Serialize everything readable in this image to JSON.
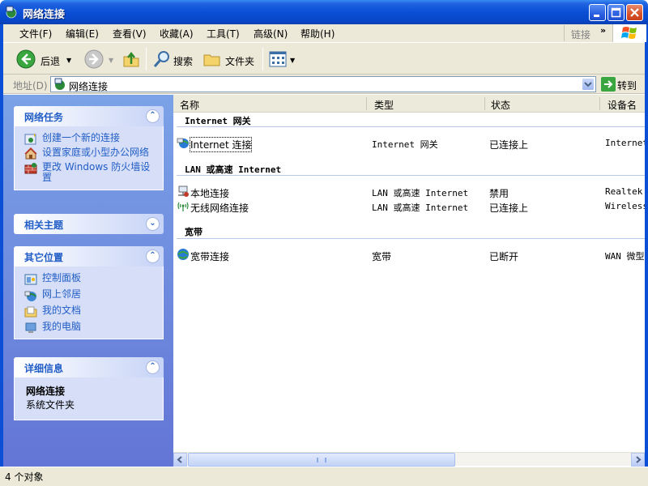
{
  "window": {
    "title": "网络连接",
    "colors": {
      "titlebar": "#0a4fd6",
      "taskpane": "#6e8bdc",
      "link": "#215dc6"
    }
  },
  "menubar": {
    "items": [
      "文件(F)",
      "编辑(E)",
      "查看(V)",
      "收藏(A)",
      "工具(T)",
      "高级(N)",
      "帮助(H)"
    ],
    "links_label": "链接",
    "links_chevron": "»"
  },
  "toolbar": {
    "back_label": "后退",
    "search_label": "搜索",
    "folders_label": "文件夹"
  },
  "addressbar": {
    "label": "地址(D)",
    "value": "网络连接",
    "go_label": "转到"
  },
  "taskpane": {
    "network_tasks": {
      "title": "网络任务",
      "toggle": "⌃",
      "items": [
        {
          "label": "创建一个新的连接",
          "icon": "new-connection-icon"
        },
        {
          "label": "设置家庭或小型办公网络",
          "icon": "home-network-icon"
        },
        {
          "label": "更改 Windows 防火墙设置",
          "icon": "firewall-icon"
        }
      ]
    },
    "related_topics": {
      "title": "相关主题",
      "toggle": "⌄"
    },
    "other_places": {
      "title": "其它位置",
      "toggle": "⌃",
      "items": [
        {
          "label": "控制面板",
          "icon": "control-panel-icon"
        },
        {
          "label": "网上邻居",
          "icon": "network-places-icon"
        },
        {
          "label": "我的文档",
          "icon": "my-documents-icon"
        },
        {
          "label": "我的电脑",
          "icon": "my-computer-icon"
        }
      ]
    },
    "details": {
      "title": "详细信息",
      "toggle": "⌃",
      "name": "网络连接",
      "type": "系统文件夹"
    }
  },
  "list": {
    "columns": [
      "名称",
      "类型",
      "状态",
      "设备名"
    ],
    "groups": [
      {
        "title": "Internet 网关",
        "rows": [
          {
            "name": "Internet 连接",
            "type": "Internet 网关",
            "status": "已连接上",
            "device": "Internet"
          }
        ]
      },
      {
        "title": "LAN 或高速 Internet",
        "rows": [
          {
            "name": "本地连接",
            "type": "LAN 或高速 Internet",
            "status": "禁用",
            "device": "Realtek"
          },
          {
            "name": "无线网络连接",
            "type": "LAN 或高速 Internet",
            "status": "已连接上",
            "device": "Wireless"
          }
        ]
      },
      {
        "title": "宽带",
        "rows": [
          {
            "name": "宽带连接",
            "type": "宽带",
            "status": "已断开",
            "device": "WAN 微型"
          }
        ]
      }
    ]
  },
  "statusbar": {
    "text": "4 个对象"
  }
}
